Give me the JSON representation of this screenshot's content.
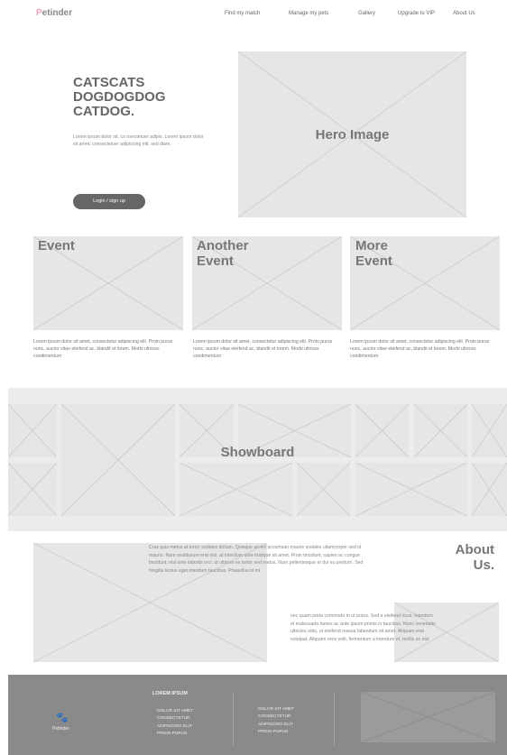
{
  "brand": {
    "first_letter": "P",
    "rest": "etinder",
    "footer_name": "Petinder"
  },
  "nav": {
    "items": [
      "Find my match",
      "Manage my pets",
      "Gallery",
      "Upgrade to VIP",
      "About Us"
    ]
  },
  "hero": {
    "title": "CATSCATS DOGDOGDOG CATDOG.",
    "text": "Lorem ipsum dolor sit, co nsectetuer adipis. Lorem ipsum dolor sit amet, consectetuer adipiscing elit, sed diam.",
    "login_label": "Login / sign up",
    "image_label": "Hero Image"
  },
  "events": [
    {
      "title": "Event",
      "text": "Lorem ipsum dolor sit amet, consectetur adipiscing elit. Proin purus nunc, auctor vitae eleifend ac, blandit et lorem. Morbi ultrices condimentum"
    },
    {
      "title": "Another Event",
      "text": "Lorem ipsum dolor sit amet, consectetur adipiscing elit. Proin purus nunc, auctor vitae eleifend ac, blandit et lorem. Morbi ultrices condimentum"
    },
    {
      "title": "More Event",
      "text": "Lorem ipsum dolor sit amet, consectetur adipiscing elit. Proin purus nunc, auctor vitae eleifend ac, blandit et lorem. Morbi ultrices condimentum"
    }
  ],
  "showboard": {
    "label": "Showboard"
  },
  "about": {
    "title": "About Us.",
    "text_top": "Cras quis metus at tortor sodales dictum. Quisque at nisl accumsan mauris sodales ullamcorper sed id mauris. Nam vestibulum erat nisl, at interdum ante tristique sit amet. Proin tincidunt, sapien ac congue tincidunt, nisl ante lobortis orci, ut ultrices ex tortor sed metus. Nam pellentesque et dui eu pretium. Sed fringilla lectus eget interdum faucibus. Phasellus id mi",
    "text_bottom": "nec quam porta commodo in ut purus. Sed a eleifend risus. Interdum et malesuada fames ac ante ipsum primis in faucibus. Nunc venenatis ultricies odio, ut eleifend massa bibendum sit amet. Aliquam erat volutpat. Aliquam eros velit, fermentum a interdum et, mollis ac nisl."
  },
  "footer": {
    "heading": "LOREM IPSUM",
    "col1": [
      "DOLOR SIT AMET",
      "CONSECTETUR",
      "ADIPISCING ELIT",
      "PROIN PURUS"
    ],
    "col2": [
      "DOLOR SIT AMET",
      "CONSECTETUR",
      "ADIPISCING ELIT",
      "PROIN PURUS"
    ]
  },
  "colors": {
    "brand_pink": "#e8a3b6",
    "placeholder": "#e6e6e6",
    "footer_bg": "#8a8a8a",
    "button": "#666666"
  },
  "icons": {
    "footer_logo": "paw-icon"
  }
}
